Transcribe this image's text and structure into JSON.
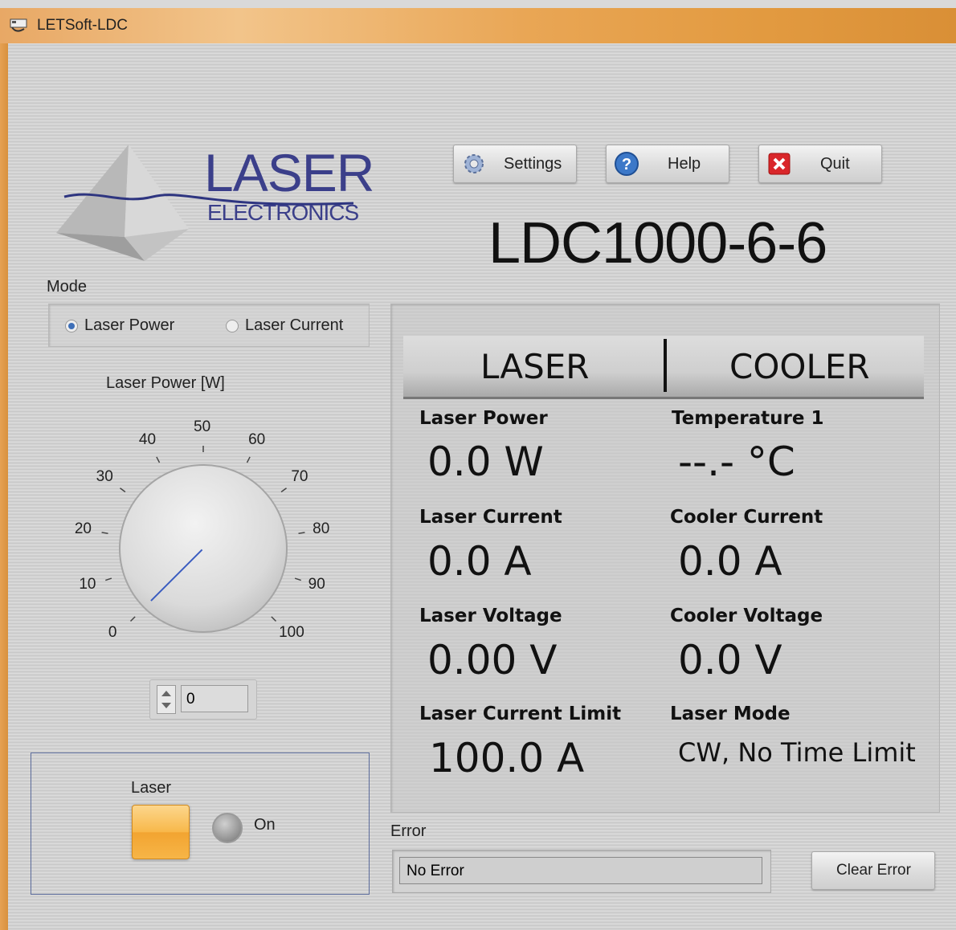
{
  "window": {
    "title": "LETSoft-LDC"
  },
  "logo": {
    "line1": "LASER",
    "line2": "ELECTRONICS"
  },
  "toolbar": {
    "settings_label": "Settings",
    "help_label": "Help",
    "quit_label": "Quit"
  },
  "model": "LDC1000-6-6",
  "mode": {
    "label": "Mode",
    "options": [
      {
        "label": "Laser Power",
        "selected": true
      },
      {
        "label": "Laser Current",
        "selected": false
      }
    ]
  },
  "knob": {
    "label": "Laser Power [W]",
    "ticks": [
      "0",
      "10",
      "20",
      "30",
      "40",
      "50",
      "60",
      "70",
      "80",
      "90",
      "100"
    ],
    "value": 0,
    "input_value": "0"
  },
  "laser_switch": {
    "label": "Laser",
    "indicator_label": "On",
    "on": false
  },
  "tabs": {
    "laser": "LASER",
    "cooler": "COOLER"
  },
  "readouts": {
    "laser_power": {
      "label": "Laser Power",
      "value": "0.0 W"
    },
    "laser_current": {
      "label": "Laser Current",
      "value": "0.0 A"
    },
    "laser_voltage": {
      "label": "Laser Voltage",
      "value": "0.00 V"
    },
    "laser_current_limit": {
      "label": "Laser Current Limit",
      "value": "100.0 A"
    },
    "temperature1": {
      "label": "Temperature 1",
      "value": "--.- °C"
    },
    "cooler_current": {
      "label": "Cooler Current",
      "value": "0.0 A"
    },
    "cooler_voltage": {
      "label": "Cooler Voltage",
      "value": "0.0 V"
    },
    "laser_mode": {
      "label": "Laser Mode",
      "value": "CW, No Time Limit"
    }
  },
  "error": {
    "label": "Error",
    "value": "No Error",
    "clear_label": "Clear Error"
  },
  "colors": {
    "brand": "#3b3f8a",
    "laser_button": "#f7b547",
    "radio_selected": "#3e6fb8"
  }
}
